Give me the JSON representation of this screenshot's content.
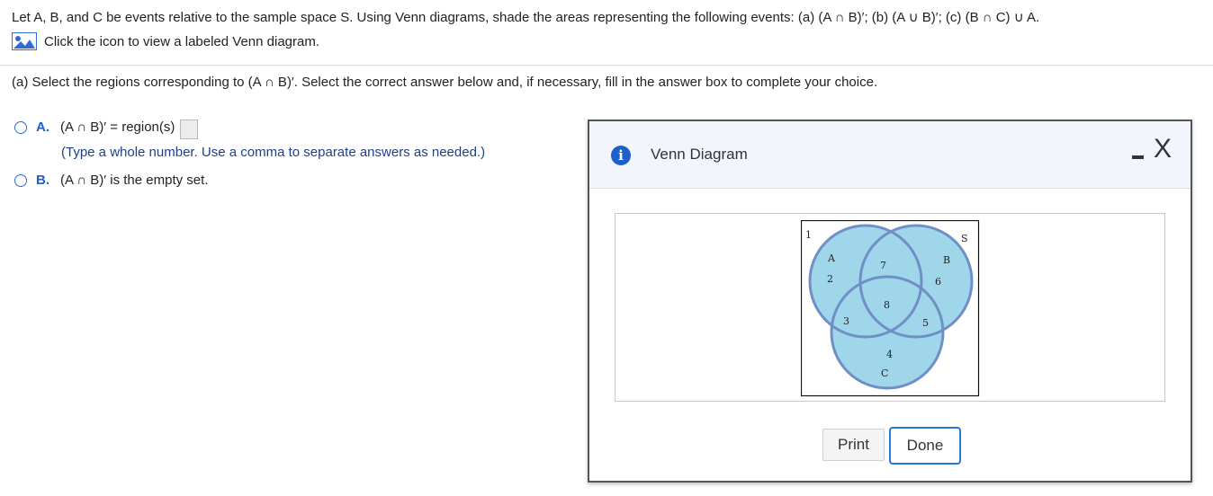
{
  "question": {
    "text": "Let A, B, and C be events relative to the sample space S. Using Venn diagrams, shade the areas representing the following events: (a) (A ∩ B)′; (b) (A ∪ B)′; (c) (B ∩ C) ∪ A.",
    "icon_link": "Click the icon to view a labeled Venn diagram."
  },
  "part_a": {
    "prompt": "(a) Select the regions corresponding to (A ∩ B)′. Select the correct answer below and, if necessary, fill in the answer box to complete your choice.",
    "option_a": {
      "letter": "A.",
      "text": "(A ∩ B)′ = region(s)",
      "answer_value": "",
      "hint": "(Type a whole number. Use a comma to separate answers as needed.)"
    },
    "option_b": {
      "letter": "B.",
      "text": "(A ∩ B)′ is the empty set."
    }
  },
  "dialog": {
    "title": "Venn Diagram",
    "info_icon": "i",
    "close_icon": "X",
    "print_label": "Print",
    "done_label": "Done",
    "venn": {
      "sample_space": "S",
      "set_a": "A",
      "set_b": "B",
      "set_c": "C",
      "regions": [
        "1",
        "2",
        "7",
        "6",
        "8",
        "3",
        "5",
        "4"
      ],
      "fill_color": "#a0d6ea",
      "stroke_color": "#6f8fc6"
    }
  }
}
